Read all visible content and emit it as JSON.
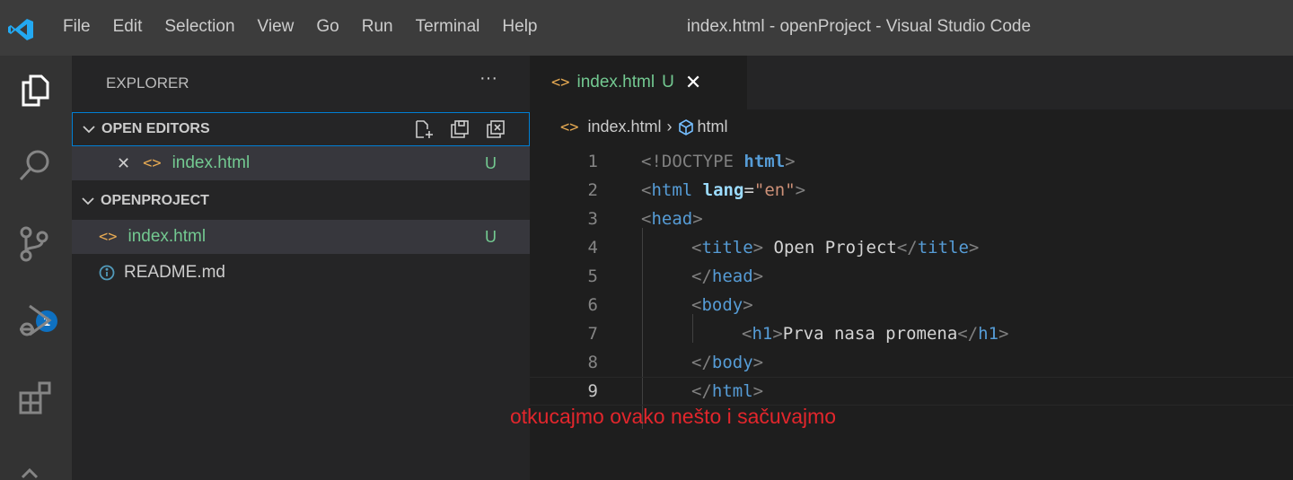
{
  "window": {
    "menu": [
      "File",
      "Edit",
      "Selection",
      "View",
      "Go",
      "Run",
      "Terminal",
      "Help"
    ],
    "title": "index.html - openProject - Visual Studio Code"
  },
  "activity_bar": {
    "items": [
      "explorer-icon",
      "search-icon",
      "source-control-icon",
      "run-debug-icon",
      "extensions-icon",
      "remote-icon"
    ],
    "source_control_badge": "1"
  },
  "sidebar": {
    "title": "EXPLORER",
    "more": "···",
    "open_editors": {
      "label": "OPEN EDITORS",
      "files": [
        {
          "close": "✕",
          "name": "index.html",
          "status": "U"
        }
      ]
    },
    "project": {
      "label": "OPENPROJECT",
      "files": [
        {
          "name": "index.html",
          "status": "U"
        },
        {
          "name": "README.md",
          "status": ""
        }
      ]
    }
  },
  "editor": {
    "tab": {
      "name": "index.html",
      "status": "U",
      "close": "✕"
    },
    "breadcrumb": {
      "file": "index.html",
      "separator": "›",
      "symbol": "html"
    },
    "line_numbers": [
      "1",
      "2",
      "3",
      "4",
      "5",
      "6",
      "7",
      "8",
      "9"
    ],
    "code": {
      "l1": {
        "open": "<!DOCTYPE ",
        "kw": "html",
        "close": ">"
      },
      "l2": {
        "open": "<",
        "tag": "html",
        "sp": " ",
        "attr": "lang",
        "eq": "=",
        "val": "\"en\"",
        "close": ">"
      },
      "l3": {
        "open": "<",
        "tag": "head",
        "close": ">"
      },
      "l4": {
        "open": "<",
        "tag": "title",
        "close": ">",
        "text": " Open Project",
        "open2": "</",
        "tag2": "title",
        "close2": ">"
      },
      "l5": {
        "open": "</",
        "tag": "head",
        "close": ">"
      },
      "l6": {
        "open": "<",
        "tag": "body",
        "close": ">"
      },
      "l7": {
        "open": "<",
        "tag": "h1",
        "close": ">",
        "text": "Prva nasa promena",
        "open2": "</",
        "tag2": "h1",
        "close2": ">"
      },
      "l8": {
        "open": "</",
        "tag": "body",
        "close": ">"
      },
      "l9": {
        "open": "</",
        "tag": "html",
        "close": ">"
      }
    }
  },
  "annotation": "otkucajmo ovako nešto i sačuvajmo",
  "colors": {
    "accent": "#007fd4",
    "git_untracked": "#73c991",
    "annotation": "#e2262c",
    "badge": "#0e70c0"
  }
}
